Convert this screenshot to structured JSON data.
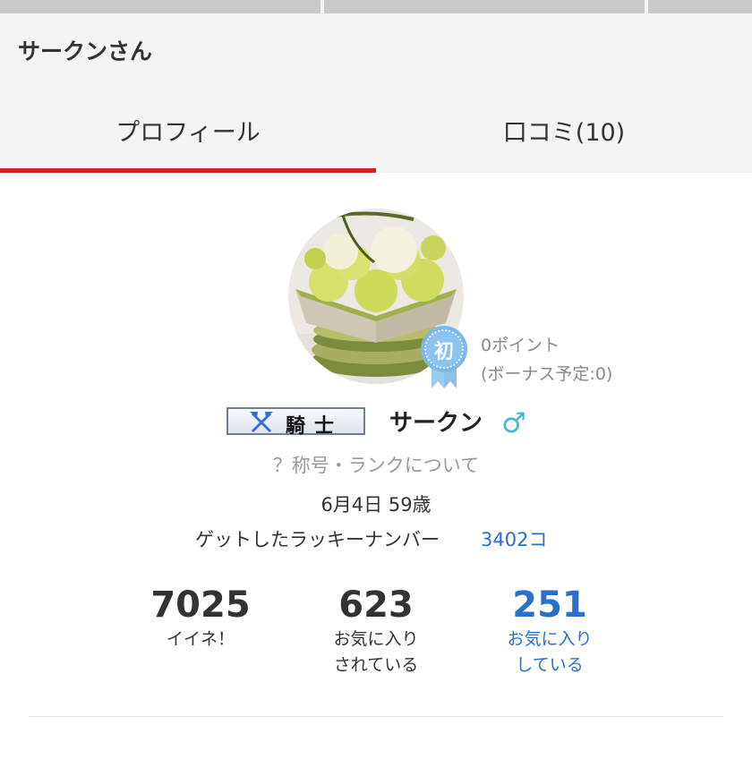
{
  "header": {
    "title": "サークンさん"
  },
  "tabs": [
    {
      "label": "プロフィール",
      "active": true
    },
    {
      "label": "口コミ(10)",
      "active": false
    }
  ],
  "profile": {
    "badge_char": "初",
    "points": "0ポイント",
    "bonus": "(ボーナス予定:0)",
    "title_plate": "騎士",
    "username": "サークン",
    "gender_symbol": "♂",
    "rank_link": "？称号・ランクについて",
    "birth": "6月4日 59歳",
    "lucky_label": "ゲットしたラッキーナンバー",
    "lucky_value": "3402コ"
  },
  "stats": [
    {
      "num": "7025",
      "label_1": "イイネ！",
      "label_2": ""
    },
    {
      "num": "623",
      "label_1": "お気に入り",
      "label_2": "されている"
    },
    {
      "num": "251",
      "label_1": "お気に入り",
      "label_2": "している"
    }
  ],
  "colors": {
    "accent_red": "#d0231c",
    "link_blue": "#2a6fc9",
    "gender_blue": "#44b7d6",
    "badge_blue": "#7ab8ea"
  },
  "icons": {
    "badge": "ribbon-badge-icon",
    "title_emblem": "crossed-axes-icon",
    "gender": "male-icon"
  }
}
